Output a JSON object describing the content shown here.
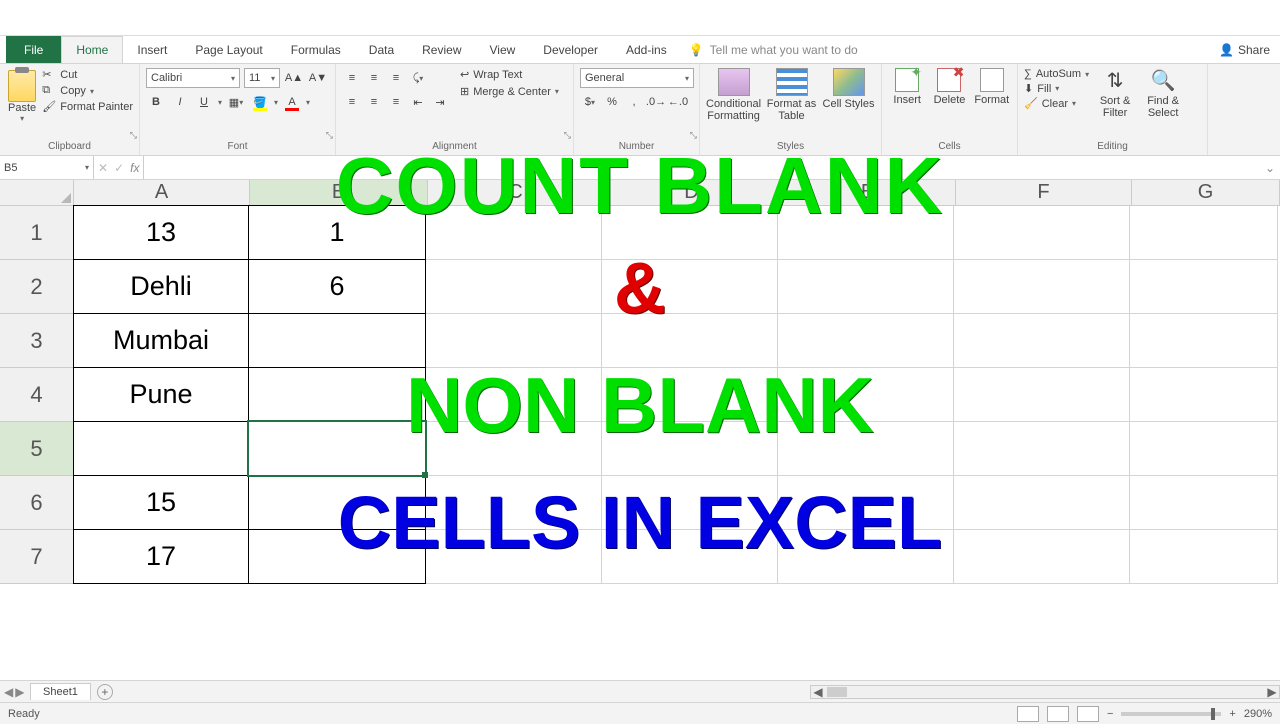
{
  "tabs": {
    "file": "File",
    "list": [
      "Home",
      "Insert",
      "Page Layout",
      "Formulas",
      "Data",
      "Review",
      "View",
      "Developer",
      "Add-ins"
    ],
    "active": "Home",
    "tellme": "Tell me what you want to do",
    "share": "Share"
  },
  "clipboard": {
    "paste": "Paste",
    "cut": "Cut",
    "copy": "Copy",
    "painter": "Format Painter",
    "label": "Clipboard"
  },
  "font": {
    "name": "Calibri",
    "size": "11",
    "label": "Font",
    "bold": "B",
    "italic": "I",
    "underline": "U"
  },
  "alignment": {
    "wrap": "Wrap Text",
    "merge": "Merge & Center",
    "label": "Alignment"
  },
  "number": {
    "format": "General",
    "label": "Number"
  },
  "styles": {
    "cond": "Conditional Formatting",
    "table": "Format as Table",
    "cell": "Cell Styles",
    "label": "Styles"
  },
  "cells": {
    "insert": "Insert",
    "delete": "Delete",
    "format": "Format",
    "label": "Cells"
  },
  "editing": {
    "autosum": "AutoSum",
    "fill": "Fill",
    "clear": "Clear",
    "sort": "Sort & Filter",
    "find": "Find & Select",
    "label": "Editing"
  },
  "namebox": "B5",
  "formula": "",
  "columns": [
    "A",
    "B",
    "C",
    "D",
    "E",
    "F",
    "G"
  ],
  "rownums": [
    "1",
    "2",
    "3",
    "4",
    "5",
    "6",
    "7"
  ],
  "griddata": {
    "A": [
      "13",
      "Dehli",
      "Mumbai",
      "Pune",
      "",
      "15",
      "17"
    ],
    "B": [
      "1",
      "6",
      "",
      "",
      "",
      "",
      ""
    ]
  },
  "selectedCell": "B5",
  "overlay": {
    "l1": "COUNT BLANK",
    "l2": "&",
    "l3": "NON BLANK",
    "l4": "CELLS IN EXCEL"
  },
  "sheet": {
    "name": "Sheet1"
  },
  "status": {
    "ready": "Ready",
    "zoom": "290%"
  }
}
